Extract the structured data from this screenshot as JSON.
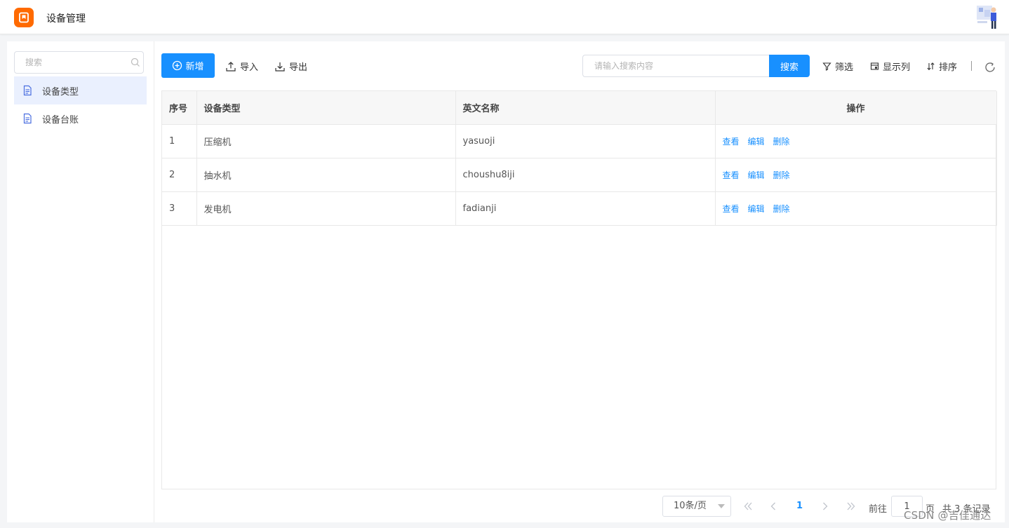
{
  "header": {
    "app_title": "设备管理"
  },
  "sidebar": {
    "search_placeholder": "搜索",
    "items": [
      {
        "label": "设备类型",
        "active": true
      },
      {
        "label": "设备台账",
        "active": false
      }
    ]
  },
  "toolbar": {
    "add_label": "新增",
    "import_label": "导入",
    "export_label": "导出",
    "search_placeholder": "请输入搜索内容",
    "search_button": "搜索",
    "filter_label": "筛选",
    "columns_label": "显示列",
    "sort_label": "排序"
  },
  "table": {
    "headers": [
      "序号",
      "设备类型",
      "英文名称",
      "操作"
    ],
    "rows": [
      {
        "index": "1",
        "type": "压缩机",
        "english": "yasuoji"
      },
      {
        "index": "2",
        "type": "抽水机",
        "english": "choushu8iji"
      },
      {
        "index": "3",
        "type": "发电机",
        "english": "fadianji"
      }
    ],
    "actions": {
      "view": "查看",
      "edit": "编辑",
      "delete": "删除"
    }
  },
  "pagination": {
    "page_size": "10条/页",
    "current_page": "1",
    "goto_prefix": "前往",
    "goto_value": "1",
    "goto_suffix": "页",
    "total": "共 3 条记录"
  },
  "watermark": "CSDN @吉佳通达",
  "colors": {
    "primary": "#1890ff",
    "logo": "#ff6a00",
    "active_bg": "#eaf0fe"
  }
}
